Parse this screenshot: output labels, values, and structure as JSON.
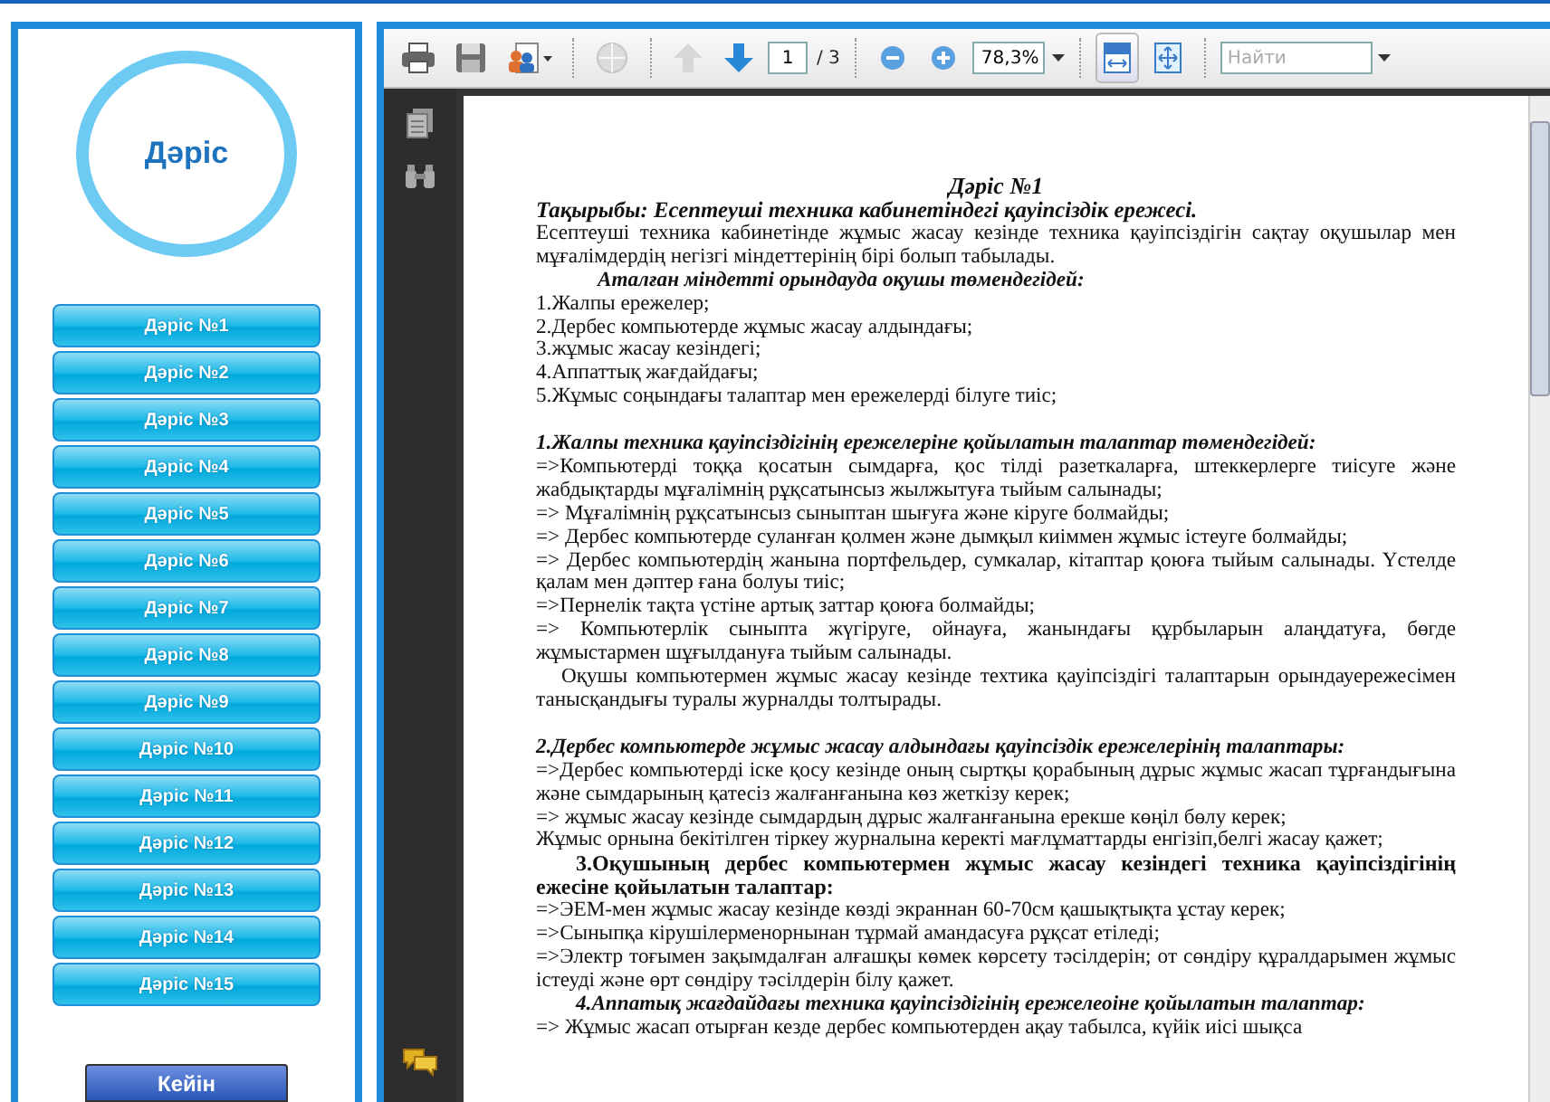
{
  "sidebar": {
    "logo": "Дәріс",
    "lectures": [
      {
        "label": "Дәріс №1"
      },
      {
        "label": "Дәріс №2"
      },
      {
        "label": "Дәріс №3"
      },
      {
        "label": "Дәріс №4"
      },
      {
        "label": "Дәріс №5"
      },
      {
        "label": "Дәріс №6"
      },
      {
        "label": "Дәріс №7"
      },
      {
        "label": "Дәріс №8"
      },
      {
        "label": "Дәріс №9"
      },
      {
        "label": "Дәріс №10"
      },
      {
        "label": "Дәріс №11"
      },
      {
        "label": "Дәріс №12"
      },
      {
        "label": "Дәріс №13"
      },
      {
        "label": "Дәріс №14"
      },
      {
        "label": "Дәріс №15"
      }
    ],
    "next_button": "Кейін"
  },
  "toolbar": [
    {
      "kind": "print",
      "disabled": false,
      "pressed": false
    },
    {
      "kind": "save",
      "disabled": false,
      "pressed": false
    },
    {
      "kind": "export",
      "disabled": false,
      "pressed": false
    },
    {
      "kind": "separator"
    },
    {
      "kind": "globe",
      "disabled": true,
      "pressed": false
    },
    {
      "kind": "separator"
    },
    {
      "kind": "prev-page",
      "disabled": true,
      "pressed": false
    },
    {
      "kind": "next-page",
      "disabled": false,
      "pressed": false
    },
    {
      "kind": "page-field",
      "value": "1",
      "total": "/ 3"
    },
    {
      "kind": "separator"
    },
    {
      "kind": "zoom-out",
      "disabled": false,
      "pressed": false
    },
    {
      "kind": "zoom-in",
      "disabled": false,
      "pressed": false
    },
    {
      "kind": "zoom-field",
      "value": "78,3%"
    },
    {
      "kind": "separator"
    },
    {
      "kind": "fit-width",
      "disabled": false,
      "pressed": true
    },
    {
      "kind": "fit-page",
      "disabled": false,
      "pressed": false
    },
    {
      "kind": "separator"
    },
    {
      "kind": "search-field",
      "placeholder": "Найти"
    }
  ],
  "side_tools": [
    {
      "kind": "pages"
    },
    {
      "kind": "find"
    },
    {
      "kind": "comments"
    }
  ],
  "document": [
    {
      "kind": "title",
      "text": "Дәріс №1"
    },
    {
      "kind": "topic",
      "text": "Тақырыбы: Есептеуші техника кабинетіндегі қауіпсіздік ережесі."
    },
    {
      "kind": "para",
      "text": "Есептеуші техника кабинетінде жұмыс жасау кезінде техника қауіпсіздігін сақтау оқушылар мен мұғалімдердің негізгі міндеттерінің бірі болып табылады."
    },
    {
      "kind": "lead",
      "text": "Аталған міндетті орындауда оқушы төмендегідей:"
    },
    {
      "kind": "item",
      "text": "1.Жалпы ережелер;"
    },
    {
      "kind": "item",
      "text": "2.Дербес компьютерде жұмыс жасау алдындағы;"
    },
    {
      "kind": "item",
      "text": "3.жұмыс жасау кезіндегі;"
    },
    {
      "kind": "item",
      "text": "4.Аппаттық жағдайдағы;"
    },
    {
      "kind": "item",
      "text": "5.Жұмыс соңындағы талаптар мен ережелерді білуге тиіс;"
    },
    {
      "kind": "section",
      "text": "1.Жалпы техника қауіпсіздігінің ережелеріне қойылатын талаптар төмендегідей:"
    },
    {
      "kind": "para",
      "text": "=>Компьютерді тоққа қосатын сымдарға, қос тілді разеткаларға, штеккерлерге тиісуге және жабдықтарды мұғалімнің рұқсатынсыз жылжытуға тыйым салынады;"
    },
    {
      "kind": "para",
      "text": "=> Мұғалімнің рұқсатынсыз сыныптан шығуға және кіруге болмайды;"
    },
    {
      "kind": "para",
      "text": "=> Дербес компьютерде суланған қолмен және дымқыл киіммен жұмыс істеуге болмайды;"
    },
    {
      "kind": "para",
      "text": "=> Дербес компьютердің жанына портфельдер, сумкалар, кітаптар қоюға тыйым салынады. Үстелде қалам мен дәптер ғана болуы тиіс;"
    },
    {
      "kind": "para",
      "text": "=>Пернелік тақта үстіне артық заттар қоюға болмайды;"
    },
    {
      "kind": "para",
      "text": "=> Компьютерлік сыныпта жүгіруге, ойнауға, жанындағы құрбыларын алаңдатуға, бөгде жұмыстармен шұғылдануға тыйым салынады."
    },
    {
      "kind": "indent",
      "text": "Оқушы компьютермен жұмыс жасау кезінде техтика қауіпсіздігі талаптарын орындауережесімен танысқандығы туралы журналды толтырады."
    },
    {
      "kind": "section",
      "text": "2.Дербес компьютерде жұмыс жасау алдындағы қауіпсіздік ережелерінің талаптары:"
    },
    {
      "kind": "para",
      "text": "=>Дербес компьютерді іске қосу кезінде оның сыртқы қорабының дұрыс жұмыс жасап тұрғандығына және сымдарының қатесіз жалғанғанына көз жеткізу керек;"
    },
    {
      "kind": "para",
      "text": "=> жұмыс жасау кезінде сымдардың дұрыс жалғанғанына ерекше көңіл бөлу керек;"
    },
    {
      "kind": "para",
      "text": "Жұмыс орнына бекітілген тіркеу журналына керекті мағлұматтарды енгізіп,белгі жасау қажет;"
    },
    {
      "kind": "subhead",
      "text": "3.Оқушының дербес компьютермен жұмыс жасау кезіндегі техника қауіпсіздігінің ежесіне қойылатын талаптар:"
    },
    {
      "kind": "para",
      "text": "=>ЭЕМ-мен жұмыс жасау кезінде көзді экраннан 60-70см қашықтықта ұстау керек;"
    },
    {
      "kind": "para",
      "text": "=>Сыныпқа кірушілерменорнынан тұрмай амандасуға рұқсат етіледі;"
    },
    {
      "kind": "para",
      "text": "=>Электр тоғымен зақымдалған алғашқы көмек көрсету тәсілдерін; от сөндіру құралдарымен жұмыс істеуді және өрт сөндіру тәсілдерін білу қажет."
    },
    {
      "kind": "subhead-italic",
      "text": "4.Аппатық жағдайдағы техника қауіпсіздігінің ережелеоіне қойылатын талаптар:"
    },
    {
      "kind": "para",
      "text": "=> Жұмыс жасап отырған кезде дербес компьютерден ақау табылса, күйік иісі шықса"
    }
  ]
}
